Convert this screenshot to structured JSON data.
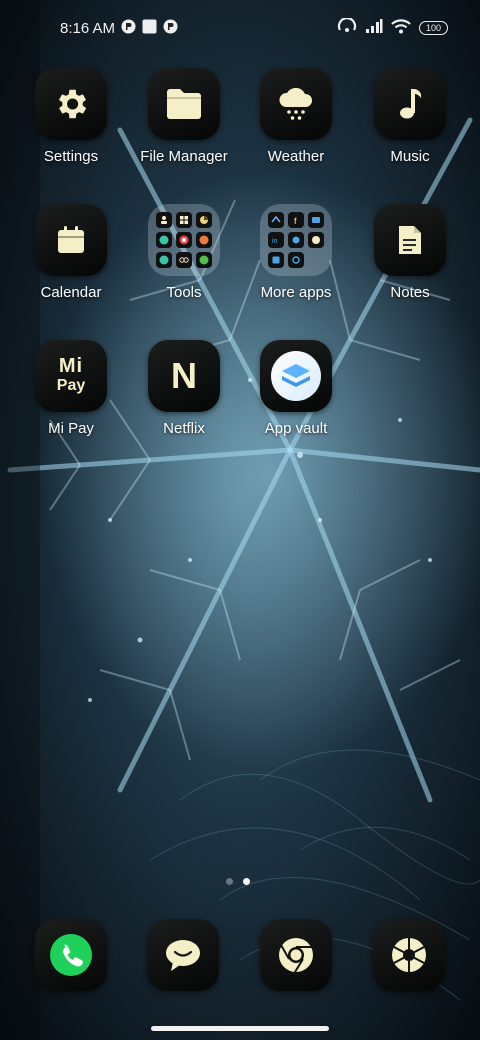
{
  "status_bar": {
    "time": "8:16 AM",
    "battery": "100",
    "left_icons": [
      "notification-icon",
      "square-notification-icon",
      "notification-icon"
    ],
    "right_icons": [
      "hotspot-icon",
      "signal-icon",
      "wifi-icon",
      "battery-icon"
    ]
  },
  "home": {
    "rows": [
      [
        {
          "label": "Settings",
          "icon": "gear-icon"
        },
        {
          "label": "File Manager",
          "icon": "folder-icon"
        },
        {
          "label": "Weather",
          "icon": "cloud-snow-icon"
        },
        {
          "label": "Music",
          "icon": "music-note-icon"
        }
      ],
      [
        {
          "label": "Calendar",
          "icon": "calendar-icon"
        },
        {
          "label": "Tools",
          "icon": "app-folder"
        },
        {
          "label": "More apps",
          "icon": "app-folder"
        },
        {
          "label": "Notes",
          "icon": "note-icon"
        }
      ],
      [
        {
          "label": "Mi Pay",
          "icon": "mi-pay-logo",
          "logo_top": "Mi",
          "logo_bottom": "Pay"
        },
        {
          "label": "Netflix",
          "icon": "netflix-logo",
          "logo": "N"
        },
        {
          "label": "App vault",
          "icon": "app-vault-icon"
        }
      ]
    ]
  },
  "page_indicator": {
    "count": 2,
    "active": 2
  },
  "dock": [
    {
      "name": "phone",
      "icon": "phone-icon"
    },
    {
      "name": "messaging",
      "icon": "chat-bubble-icon"
    },
    {
      "name": "browser",
      "icon": "chrome-icon"
    },
    {
      "name": "camera",
      "icon": "camera-shutter-icon"
    }
  ],
  "colors": {
    "icon_cream": "#f5efc8",
    "phone_green": "#1fd05a",
    "tile_dark": "#0b0c0c"
  }
}
